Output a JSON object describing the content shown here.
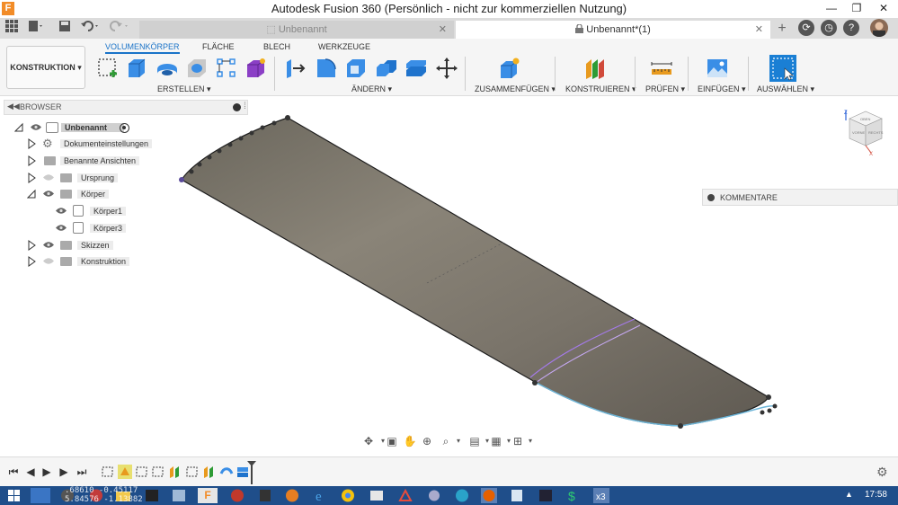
{
  "window": {
    "title": "Autodesk Fusion 360 (Persönlich - nicht zur kommerziellen Nutzung)",
    "minimize": "—",
    "maximize": "❐",
    "close": "✕",
    "app_icon_letter": "F"
  },
  "tabs": {
    "items": [
      {
        "label": "Unbenannt",
        "active": false
      },
      {
        "label": "Unbenannt*(1)",
        "active": true,
        "locked": true
      }
    ],
    "close_glyph": "✕",
    "add_glyph": "+"
  },
  "toolbar": {
    "workspace": "KONSTRUKTION ▾",
    "workspace_tabs": [
      "VOLUMENKÖRPER",
      "FLÄCHE",
      "BLECH",
      "WERKZEUGE"
    ],
    "groups": [
      "ERSTELLEN ▾",
      "ÄNDERN ▾",
      "ZUSAMMENFÜGEN ▾",
      "KONSTRUIEREN ▾",
      "PRÜFEN ▾",
      "EINFÜGEN ▾",
      "AUSWÄHLEN ▾"
    ],
    "colors": {
      "accent": "#1a73c8",
      "select_blue": "#1a7fd4"
    }
  },
  "browser": {
    "title": "BROWSER",
    "items": [
      {
        "label": "Unbenannt",
        "name": "root"
      },
      {
        "label": "Dokumenteinstellungen",
        "name": "document-settings"
      },
      {
        "label": "Benannte Ansichten",
        "name": "named-views"
      },
      {
        "label": "Ursprung",
        "name": "origin"
      },
      {
        "label": "Körper",
        "name": "bodies"
      },
      {
        "label": "Körper1",
        "name": "body-1"
      },
      {
        "label": "Körper3",
        "name": "body-3"
      },
      {
        "label": "Skizzen",
        "name": "sketches"
      },
      {
        "label": "Konstruktion",
        "name": "construction"
      }
    ]
  },
  "comments": {
    "label": "KOMMENTARE"
  },
  "viewcube": {
    "face_labels": [
      "OBEN",
      "VORNE",
      "RECHTS"
    ]
  },
  "taskbar": {
    "clock": "17:58",
    "coords_line1": ".68610   -0.45117",
    "coords_line2": "5.84576   -1.13882"
  }
}
